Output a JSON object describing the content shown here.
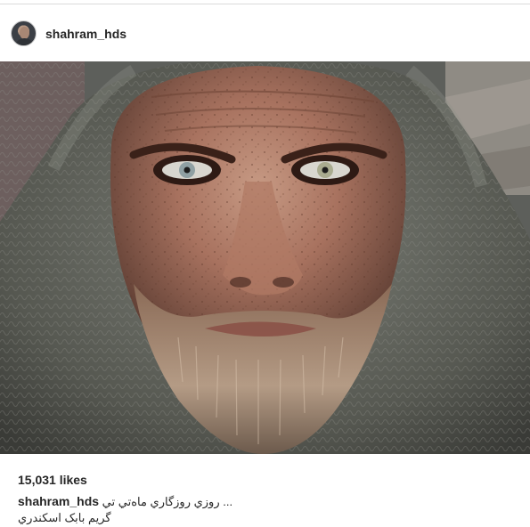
{
  "post": {
    "username": "shahram_hds",
    "likes_text": "15,031 likes",
    "caption_user": "shahram_hds",
    "caption_line1": "روزي روزگاري ماه‌تي تي ...",
    "caption_line2": "گریم بابک اسکندري"
  },
  "photo": {
    "subject": "close-up portrait of a bearded man in a knitted grey hood"
  },
  "colors": {
    "text": "#262626",
    "divider": "#dbdbdb",
    "background": "#ffffff"
  }
}
